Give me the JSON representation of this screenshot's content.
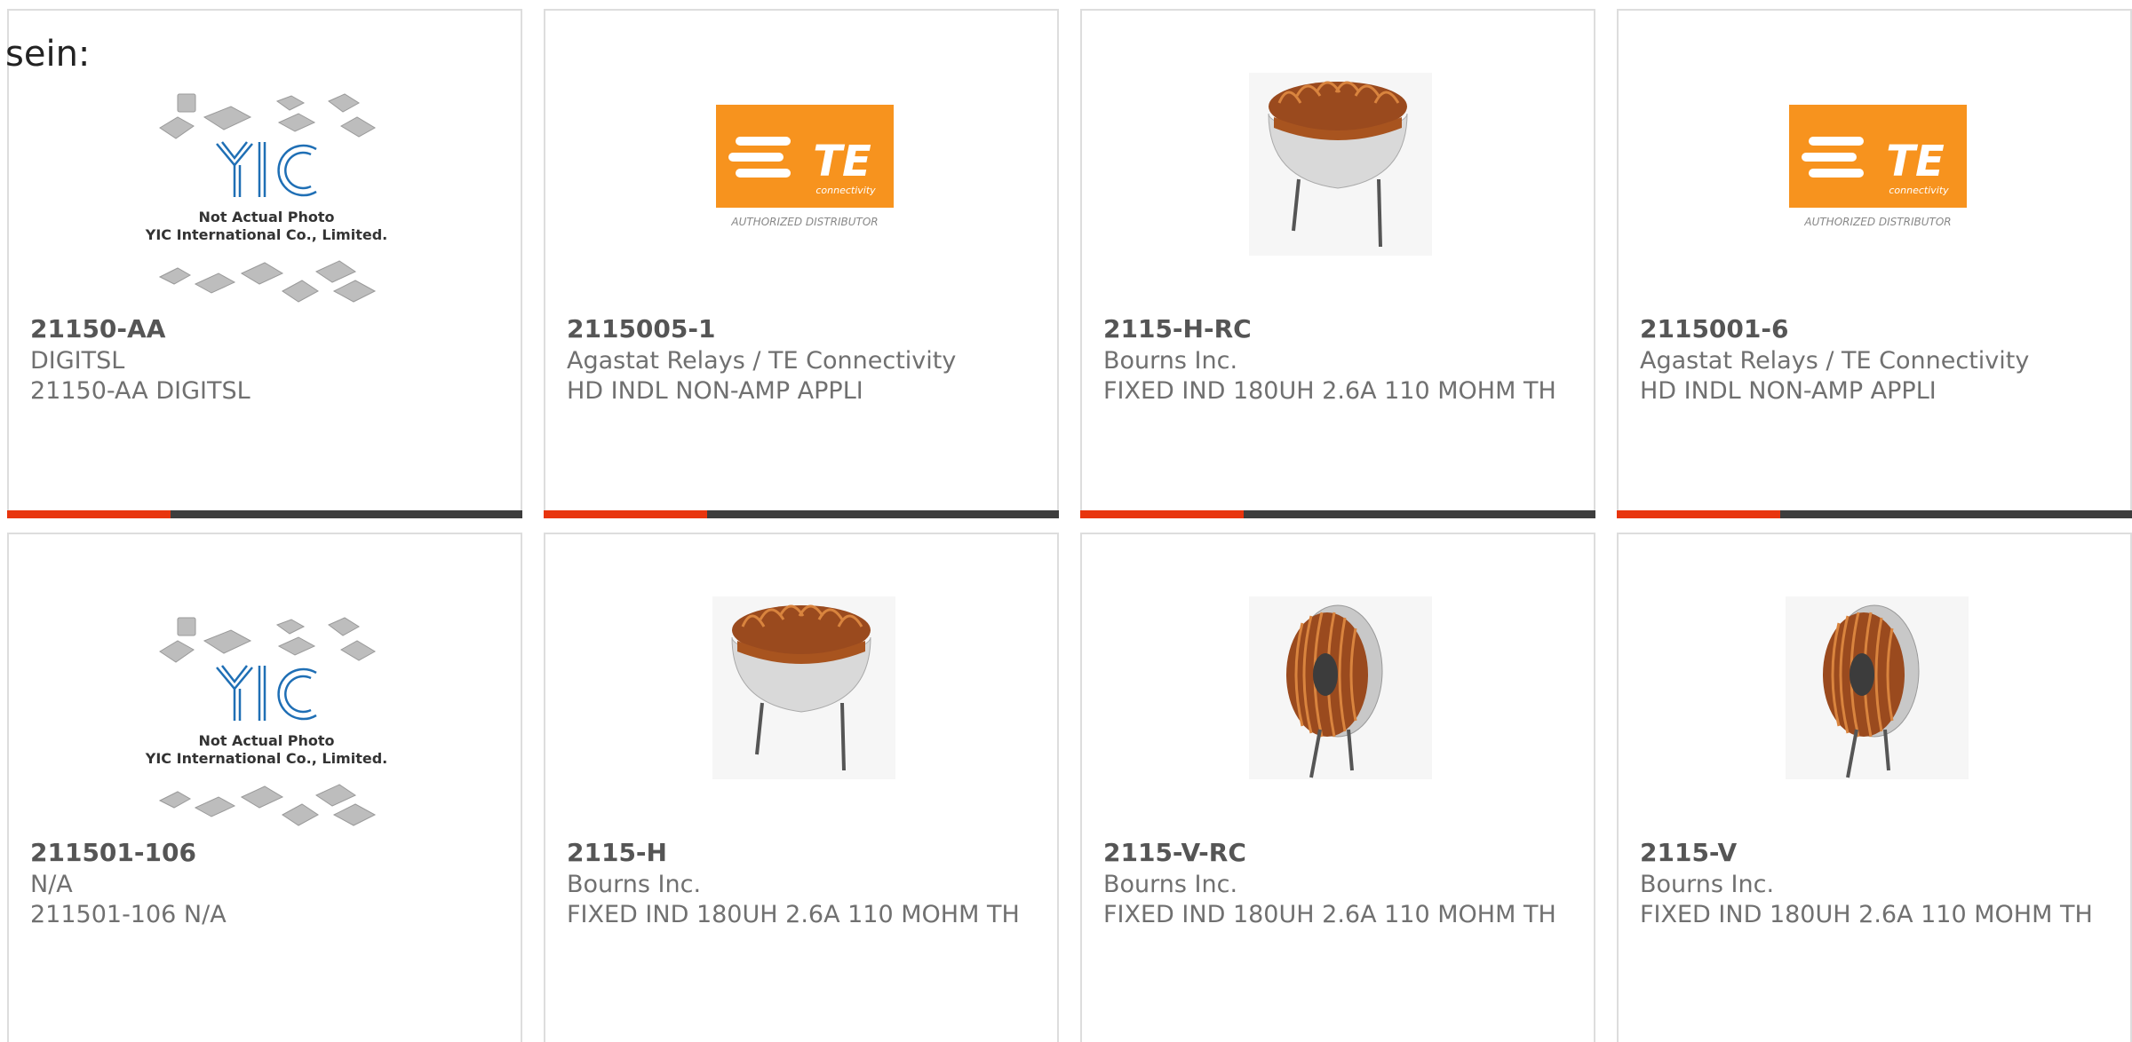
{
  "header": {
    "fragment_text": "sein:"
  },
  "colors": {
    "accent": "#e8350e",
    "bar": "#3d3d3d",
    "te_orange": "#f7931e",
    "yic_blue": "#1f6fb5"
  },
  "products": [
    {
      "part": "21150-AA",
      "maker": "DIGITSL",
      "desc": "21150-AA DIGITSL",
      "image": "yic-placeholder-image"
    },
    {
      "part": "2115005-1",
      "maker": "Agastat Relays / TE Connectivity",
      "desc": "HD INDL NON-AMP APPLI",
      "image": "te-logo-image"
    },
    {
      "part": "2115-H-RC",
      "maker": "Bourns Inc.",
      "desc": "FIXED IND 180UH 2.6A 110 MOHM TH",
      "image": "horizontal-toroid-inductor-image"
    },
    {
      "part": "2115001-6",
      "maker": "Agastat Relays / TE Connectivity",
      "desc": "HD INDL NON-AMP APPLI",
      "image": "te-logo-image"
    },
    {
      "part": "211501-106",
      "maker": "N/A",
      "desc": "211501-106 N/A",
      "image": "yic-placeholder-image"
    },
    {
      "part": "2115-H",
      "maker": "Bourns Inc.",
      "desc": "FIXED IND 180UH 2.6A 110 MOHM TH",
      "image": "horizontal-toroid-inductor-image"
    },
    {
      "part": "2115-V-RC",
      "maker": "Bourns Inc.",
      "desc": "FIXED IND 180UH 2.6A 110 MOHM TH",
      "image": "vertical-toroid-inductor-image"
    },
    {
      "part": "2115-V",
      "maker": "Bourns Inc.",
      "desc": "FIXED IND 180UH 2.6A 110 MOHM TH",
      "image": "vertical-toroid-inductor-image"
    }
  ],
  "te_logo": {
    "brand": "TE",
    "sub": "connectivity",
    "tagline": "AUTHORIZED DISTRIBUTOR"
  },
  "yic": {
    "logo": "YIC",
    "line1": "Not Actual Photo",
    "line2": "YIC International Co., Limited."
  }
}
